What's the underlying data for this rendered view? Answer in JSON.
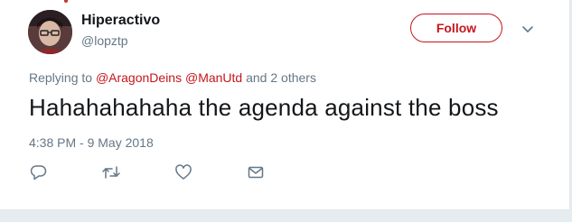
{
  "user": {
    "display_name": "Hiperactivo",
    "handle": "@lopztp"
  },
  "follow_button": {
    "label": "Follow"
  },
  "reply_context": {
    "prefix": "Replying to",
    "mentions": [
      "@AragonDeins",
      "@ManUtd"
    ],
    "suffix": "and 2 others"
  },
  "tweet": {
    "text": "Hahahahahaha the agenda against the boss",
    "timestamp": "4:38 PM - 9 May 2018"
  },
  "actions": [
    {
      "icon": "reply-icon"
    },
    {
      "icon": "retweet-icon"
    },
    {
      "icon": "like-icon"
    },
    {
      "icon": "direct-message-icon"
    }
  ],
  "colors": {
    "accent": "#c4161c",
    "text_primary": "#14171a",
    "text_secondary": "#657786",
    "background": "#e6ecf0"
  }
}
